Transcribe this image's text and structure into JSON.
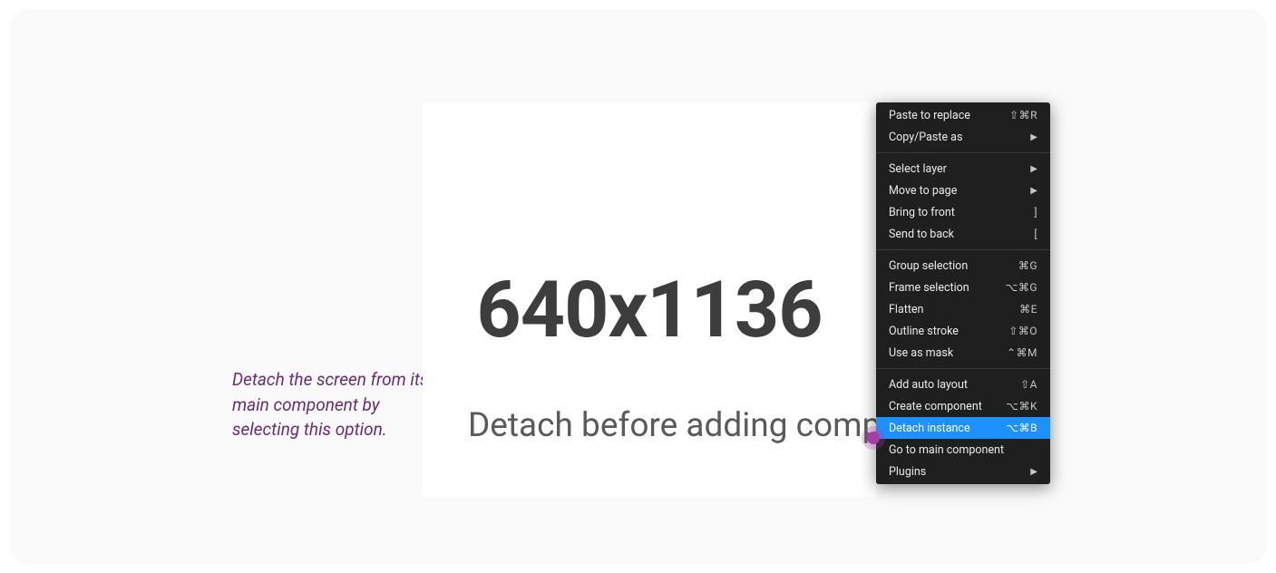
{
  "annotation": {
    "text": "Detach the screen from its main component by selecting this option."
  },
  "canvas": {
    "dimensions_label": "640x1136",
    "subtitle": "Detach before adding components"
  },
  "menu": {
    "groups": [
      [
        {
          "label": "Paste to replace",
          "shortcut": "⇧⌘R",
          "submenu": false
        },
        {
          "label": "Copy/Paste as",
          "shortcut": "",
          "submenu": true
        }
      ],
      [
        {
          "label": "Select layer",
          "shortcut": "",
          "submenu": true
        },
        {
          "label": "Move to page",
          "shortcut": "",
          "submenu": true
        },
        {
          "label": "Bring to front",
          "shortcut": "]",
          "submenu": false
        },
        {
          "label": "Send to back",
          "shortcut": "[",
          "submenu": false
        }
      ],
      [
        {
          "label": "Group selection",
          "shortcut": "⌘G",
          "submenu": false
        },
        {
          "label": "Frame selection",
          "shortcut": "⌥⌘G",
          "submenu": false
        },
        {
          "label": "Flatten",
          "shortcut": "⌘E",
          "submenu": false
        },
        {
          "label": "Outline stroke",
          "shortcut": "⇧⌘O",
          "submenu": false
        },
        {
          "label": "Use as mask",
          "shortcut": "⌃⌘M",
          "submenu": false
        }
      ],
      [
        {
          "label": "Add auto layout",
          "shortcut": "⇧A",
          "submenu": false
        },
        {
          "label": "Create component",
          "shortcut": "⌥⌘K",
          "submenu": false
        },
        {
          "label": "Detach instance",
          "shortcut": "⌥⌘B",
          "submenu": false,
          "highlight": true
        },
        {
          "label": "Go to main component",
          "shortcut": "",
          "submenu": false
        },
        {
          "label": "Plugins",
          "shortcut": "",
          "submenu": true
        }
      ]
    ]
  }
}
